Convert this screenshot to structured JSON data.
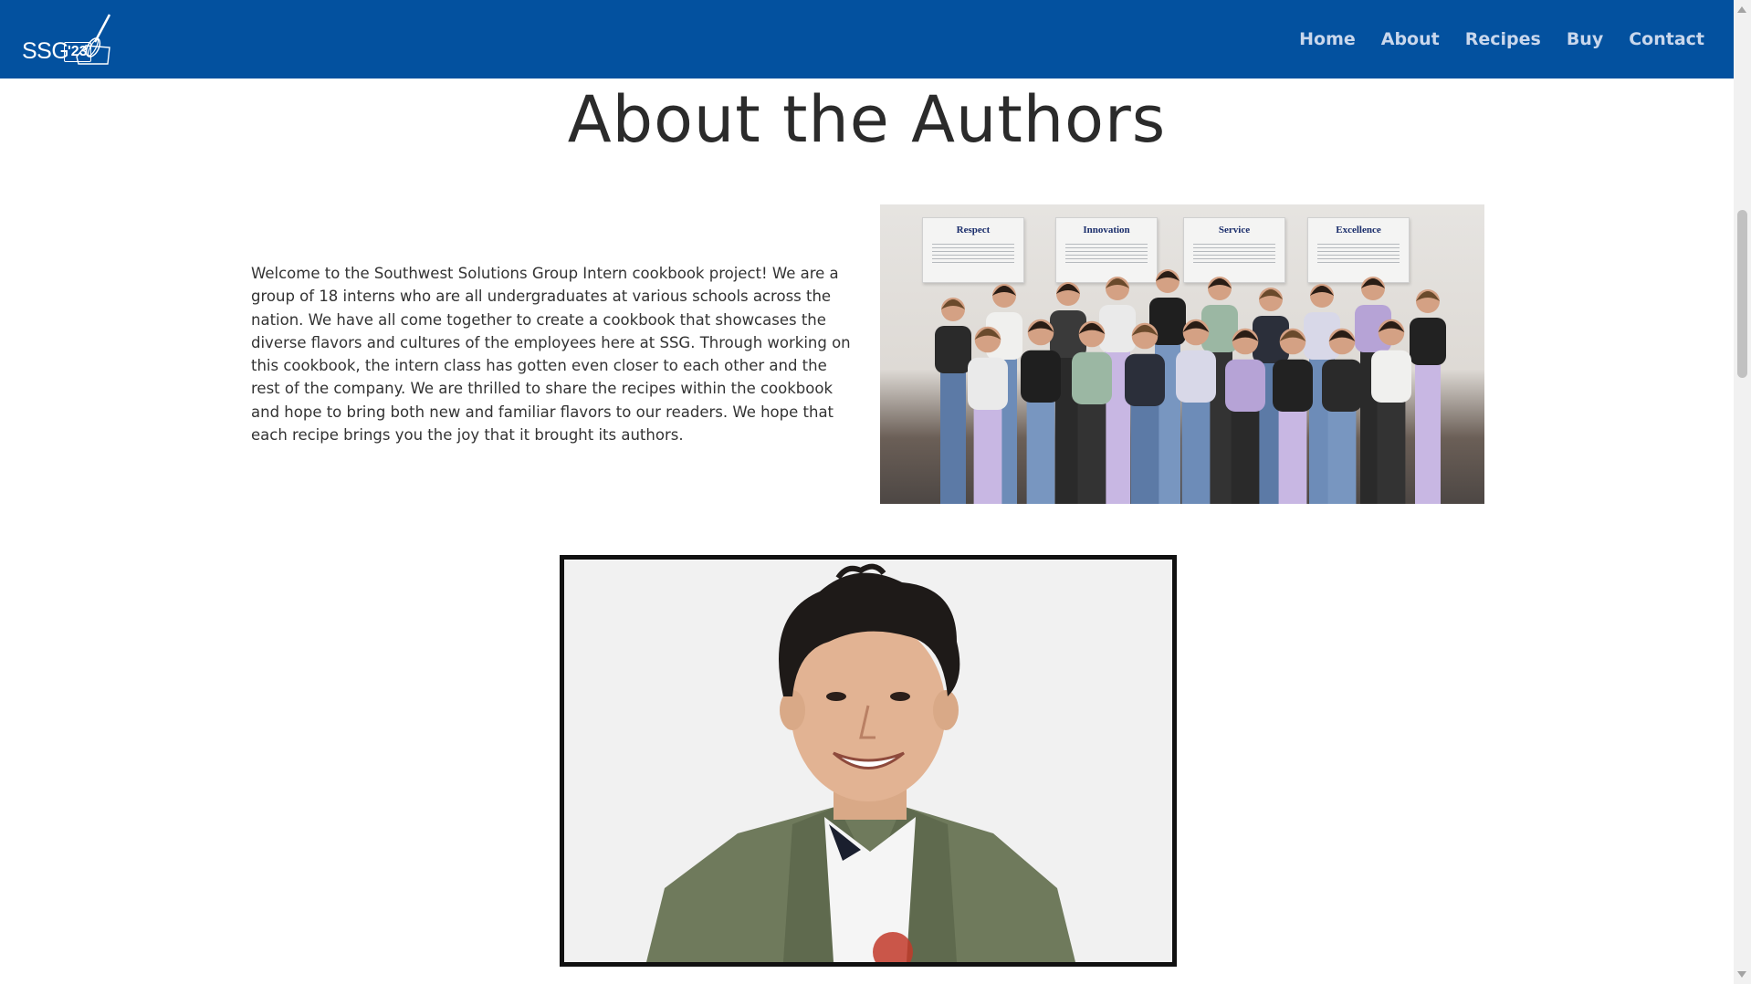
{
  "header": {
    "logo_text": "SSG",
    "logo_year": "'23",
    "background_color": "#03519f",
    "nav": [
      {
        "label": "Home"
      },
      {
        "label": "About"
      },
      {
        "label": "Recipes"
      },
      {
        "label": "Buy"
      },
      {
        "label": "Contact"
      }
    ]
  },
  "main": {
    "title": "About the Authors",
    "intro": "Welcome to the Southwest Solutions Group Intern cookbook project! We are a group of 18 interns who are all undergraduates at various schools across the nation. We have all come together to create a cookbook that showcases the diverse flavors and cultures of the employees here at SSG. Through working on this cookbook, the intern class has gotten even closer to each other and the rest of the company. We are thrilled to share the recipes within the cookbook and hope to bring both new and familiar flavors to our readers. We hope that each recipe brings you the joy that it brought its authors.",
    "group_photo": {
      "signs": [
        "Respect",
        "Innovation",
        "Service",
        "Excellence"
      ]
    }
  },
  "scrollbar": {
    "up_icon": "chevron-up-icon",
    "down_icon": "chevron-down-icon"
  }
}
